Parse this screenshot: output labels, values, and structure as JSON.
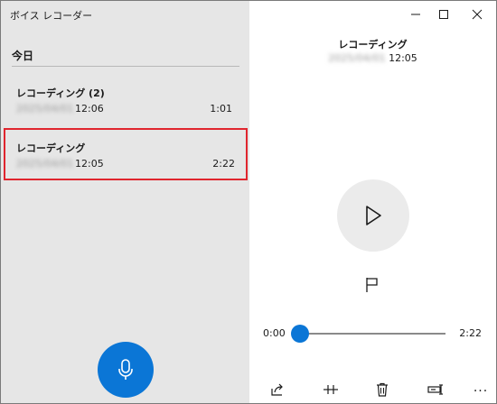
{
  "app": {
    "title": "ボイス レコーダー"
  },
  "window_controls": {
    "minimize_icon": "minimize-icon",
    "maximize_icon": "maximize-icon",
    "close_icon": "close-icon"
  },
  "list": {
    "group_header": "今日",
    "items": [
      {
        "name": "レコーディング (2)",
        "date": "2025/04/01",
        "time": "12:06",
        "duration": "1:01",
        "selected": false
      },
      {
        "name": "レコーディング",
        "date": "2025/04/01",
        "time": "12:05",
        "duration": "2:22",
        "selected": true
      }
    ],
    "selection_outline_color": "#e0252e"
  },
  "record_button": {
    "icon": "microphone-icon",
    "color": "#0b76d6"
  },
  "player": {
    "title": "レコーディング",
    "date": "2025/04/01",
    "time": "12:05",
    "play_icon": "play-icon",
    "marker_icon": "flag-icon",
    "position": "0:00",
    "length": "2:22",
    "progress_fraction": 0,
    "accent_color": "#0b76d6"
  },
  "toolbar": {
    "icons": [
      "share-icon",
      "trim-icon",
      "delete-icon",
      "rename-icon",
      "more-icon"
    ],
    "more_label": "..."
  }
}
